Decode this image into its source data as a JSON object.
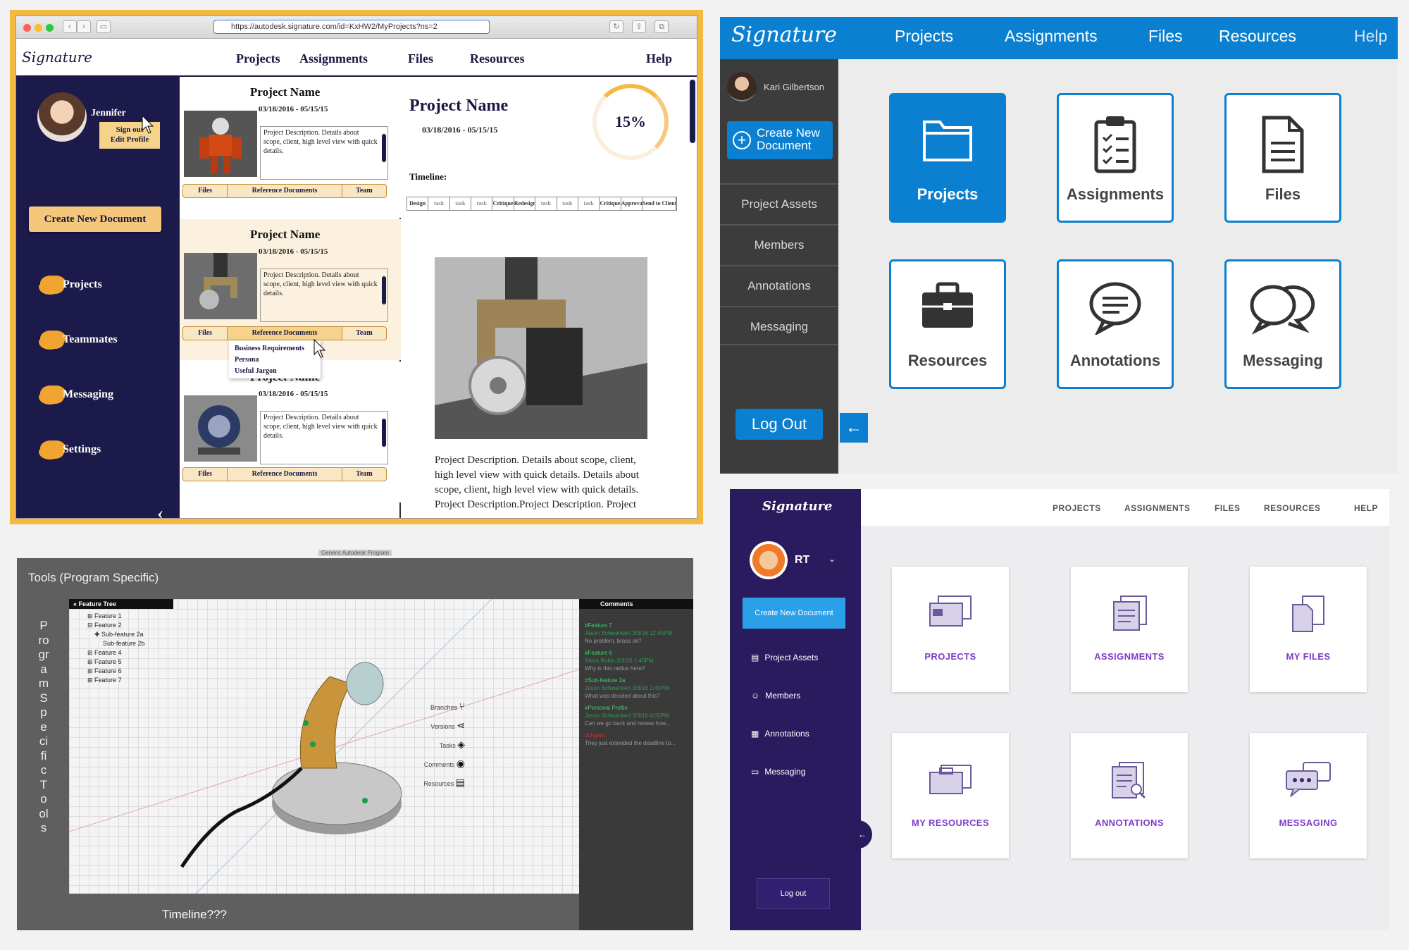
{
  "panelA": {
    "url": "https://autodesk.signature.com/id=KxHW2/MyProjects?ns=2",
    "logo": "Signature",
    "nav": [
      "Projects",
      "Assignments",
      "Files",
      "Resources",
      "Help"
    ],
    "user": {
      "name": "Jennifer",
      "menu": [
        "Sign out",
        "Edit Profile"
      ]
    },
    "create_button": "Create New Document",
    "sidebar": [
      "Projects",
      "Teammates",
      "Messaging",
      "Settings"
    ],
    "cards": [
      {
        "name": "Project Name",
        "dates": "03/18/2016 - 05/15/15",
        "description": "Project Description. Details about scope, client, high level view with quick details.",
        "tabs": [
          "Files",
          "Reference Documents",
          "Team"
        ]
      },
      {
        "name": "Project Name",
        "dates": "03/18/2016 - 05/15/15",
        "description": "Project Description. Details about scope, client, high level view with quick details.",
        "tabs": [
          "Files",
          "Reference Documents",
          "Team"
        ]
      },
      {
        "name": "Project Name",
        "dates": "03/18/2016 - 05/15/15",
        "description": "Project Description. Details about scope, client, high level view with quick details.",
        "tabs": [
          "Files",
          "Reference Documents",
          "Team"
        ]
      }
    ],
    "dropdown": [
      "Business Requirements",
      "Persona",
      "Useful Jargon"
    ],
    "detail": {
      "title": "Project Name",
      "dates": "03/18/2016 - 05/15/15",
      "progress_label": "15%",
      "progress": 0.15,
      "timeline_label": "Timeline:",
      "timeline": [
        "Design",
        "task",
        "task",
        "task",
        "Critique",
        "Redesign",
        "task",
        "task",
        "task",
        "Critique",
        "Approval",
        "Send to Client"
      ],
      "description": "Project Description. Details about scope, client, high level view with quick details. Details about scope, client, high level view with quick details. Project Description.Project Description. Project"
    }
  },
  "panelB": {
    "logo": "Signature",
    "nav": [
      "Projects",
      "Assignments",
      "Files",
      "Resources",
      "Help"
    ],
    "user": "Kari Gilbertson",
    "create_button": "Create New Document",
    "sidebar": [
      "Project Assets",
      "Members",
      "Annotations",
      "Messaging"
    ],
    "logout": "Log Out",
    "tiles": [
      {
        "label": "Projects",
        "icon": "folder-icon"
      },
      {
        "label": "Assignments",
        "icon": "clipboard-icon"
      },
      {
        "label": "Files",
        "icon": "document-icon"
      },
      {
        "label": "Resources",
        "icon": "briefcase-icon"
      },
      {
        "label": "Annotations",
        "icon": "speech-bubble-icon"
      },
      {
        "label": "Messaging",
        "icon": "chat-bubbles-icon"
      }
    ],
    "colors": {
      "accent": "#0b80d0",
      "sidebar": "#3c3c3c"
    }
  },
  "panelC": {
    "caption": "Generic Autodesk Program",
    "title": "Tools (Program Specific)",
    "vertical_label": "Program Specific Tools",
    "feature_tree_title": "Feature Tree",
    "features": [
      "Feature 1",
      "Feature 2",
      "Sub-feature 2a",
      "Sub-feature 2b",
      "Feature 4",
      "Feature 5",
      "Feature 6",
      "Feature 7"
    ],
    "tools": [
      "Branches",
      "Versions",
      "Tasks",
      "Comments",
      "Resources"
    ],
    "comments_title": "Comments",
    "comments": [
      {
        "tag": "#Feature 7",
        "meta": "Jason Schwankert  3/3/16 12:45PM",
        "text": "No problem, brass ok?"
      },
      {
        "tag": "#Feature 6",
        "meta": "Alexa Rubin 3/3/16  1:45PM",
        "text": "Why is this radius here?"
      },
      {
        "tag": "#Sub-feature 2a",
        "meta": "Jason Schwankert  3/3/16 2:45PM",
        "text": "What was decided about this?"
      },
      {
        "tag": "#Personal Profile",
        "meta": "Jason Schwankert  3/3/16 4:05PM",
        "text": "Can we go back and review how..."
      },
      {
        "tag": "#Urgent",
        "meta": "",
        "text": "They just extended the deadline to..."
      }
    ],
    "timeline": "Timeline???"
  },
  "panelD": {
    "logo": "Signature",
    "nav": [
      "PROJECTS",
      "ASSIGNMENTS",
      "FILES",
      "RESOURCES",
      "HELP"
    ],
    "user": "RT",
    "create_button": "Create New Document",
    "sidebar": [
      "Project Assets",
      "Members",
      "Annotations",
      "Messaging"
    ],
    "logout": "Log out",
    "tiles": [
      "PROJECTS",
      "ASSIGNMENTS",
      "MY FILES",
      "MY RESOURCES",
      "ANNOTATIONS",
      "MESSAGING"
    ],
    "colors": {
      "accent": "#7d3cc8",
      "sidebar": "#2a1a5e"
    }
  }
}
